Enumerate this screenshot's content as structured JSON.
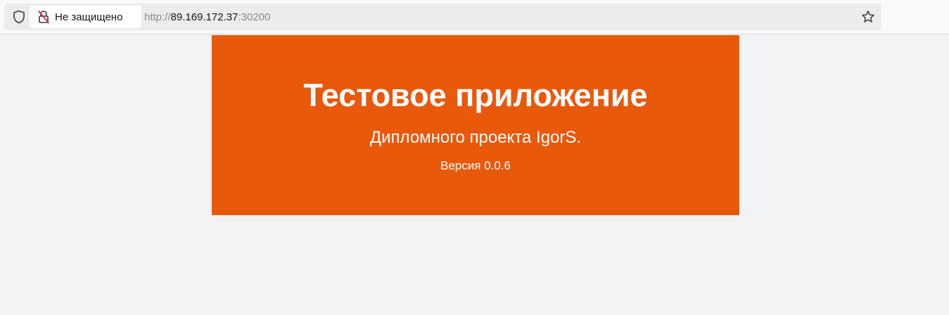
{
  "browser": {
    "security_label": "Не защищено",
    "url_scheme": "http://",
    "url_host": "89.169.172.37",
    "url_port": ":30200",
    "icons": {
      "tracking_protection": "shield-icon",
      "insecure": "insecure-lock-icon",
      "bookmark": "star-icon"
    }
  },
  "page": {
    "title": "Тестовое приложение",
    "subtitle": "Дипломного проекта IgorS.",
    "version": "Версия 0.0.6",
    "banner_color": "#e8590c",
    "background_color": "#f2f3f4"
  }
}
